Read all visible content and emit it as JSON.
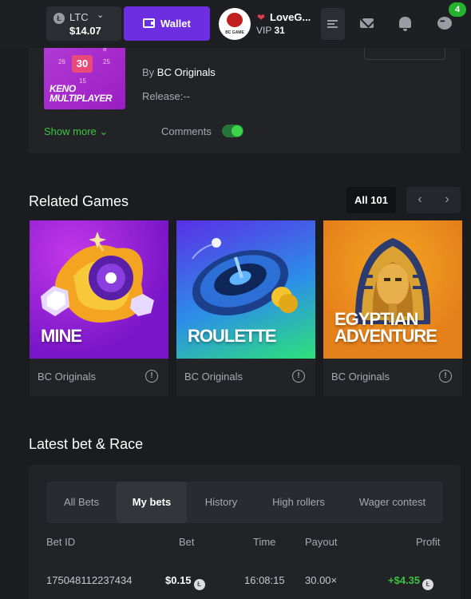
{
  "header": {
    "currency": "LTC",
    "balance": "$14.07",
    "wallet_label": "Wallet",
    "avatar_text": "BC GAME",
    "username": "LoveG...",
    "vip_label": "VIP",
    "vip_level": "31",
    "notification_count": "4"
  },
  "game_info": {
    "thumb_title_line1": "KENO",
    "thumb_title_line2": "MULTIPLAYER",
    "thumb_numbers": [
      "26",
      "30",
      "25",
      "15",
      "8"
    ],
    "provider_prefix": "By",
    "provider": "BC Originals",
    "release": "Release:--",
    "show_more": "Show more",
    "comments": "Comments",
    "comments_enabled": true
  },
  "related": {
    "title": "Related Games",
    "all_label": "All 101",
    "games": [
      {
        "name": "MINE",
        "provider": "BC Originals"
      },
      {
        "name": "ROULETTE",
        "provider": "BC Originals"
      },
      {
        "name_line1": "EGYPTIAN",
        "name_line2": "ADVENTURE",
        "provider": "BC Originals"
      }
    ]
  },
  "latest": {
    "title": "Latest bet & Race",
    "tabs": [
      "All Bets",
      "My bets",
      "History",
      "High rollers",
      "Wager contest"
    ],
    "active_tab": "My bets",
    "columns": [
      "Bet ID",
      "Bet",
      "Time",
      "Payout",
      "Profit"
    ],
    "rows": [
      {
        "bet_id": "175048112237434",
        "bet": "$0.15",
        "time": "16:08:15",
        "payout": "30.00×",
        "profit": "+$4.35"
      }
    ]
  },
  "colors": {
    "accent_purple": "#6c2ee0",
    "accent_green": "#3bc440",
    "background": "#1b1c20"
  }
}
